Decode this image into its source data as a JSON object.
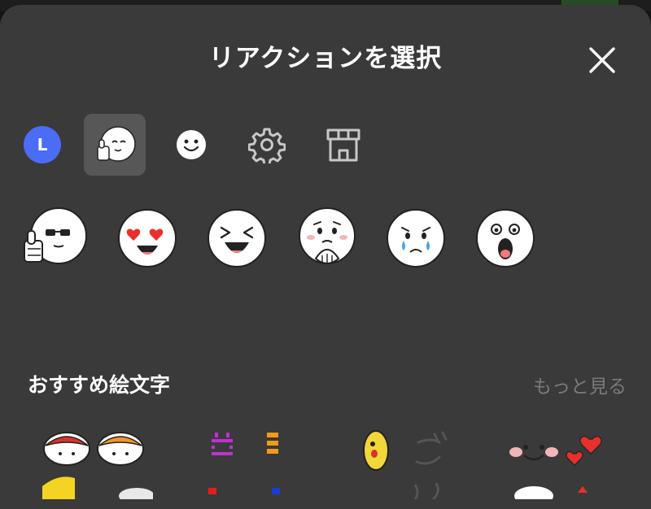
{
  "header": {
    "title": "リアクションを選択",
    "close_icon": "close-icon"
  },
  "tabs": [
    {
      "name": "tab-line-account",
      "label": "L",
      "icon": "L-badge",
      "active": false
    },
    {
      "name": "tab-line-friends",
      "icon": "thumbs-up-face-icon",
      "active": true
    },
    {
      "name": "tab-emoji",
      "icon": "smile-icon",
      "active": false
    },
    {
      "name": "tab-settings",
      "icon": "gear-icon",
      "active": false
    },
    {
      "name": "tab-shop",
      "icon": "shop-icon",
      "active": false
    }
  ],
  "reactions": [
    {
      "name": "thumbs-up-sunglasses-reaction"
    },
    {
      "name": "heart-eyes-reaction"
    },
    {
      "name": "laughing-reaction"
    },
    {
      "name": "touched-reaction"
    },
    {
      "name": "crying-reaction"
    },
    {
      "name": "surprised-reaction"
    }
  ],
  "recommended": {
    "title": "おすすめ絵文字",
    "more_label": "もっと見る"
  },
  "colors": {
    "sheet_bg": "#3a3a3a",
    "active_tab_bg": "#575757",
    "accent_blue": "#4b6cf5",
    "more_text": "#7a7a7a"
  }
}
